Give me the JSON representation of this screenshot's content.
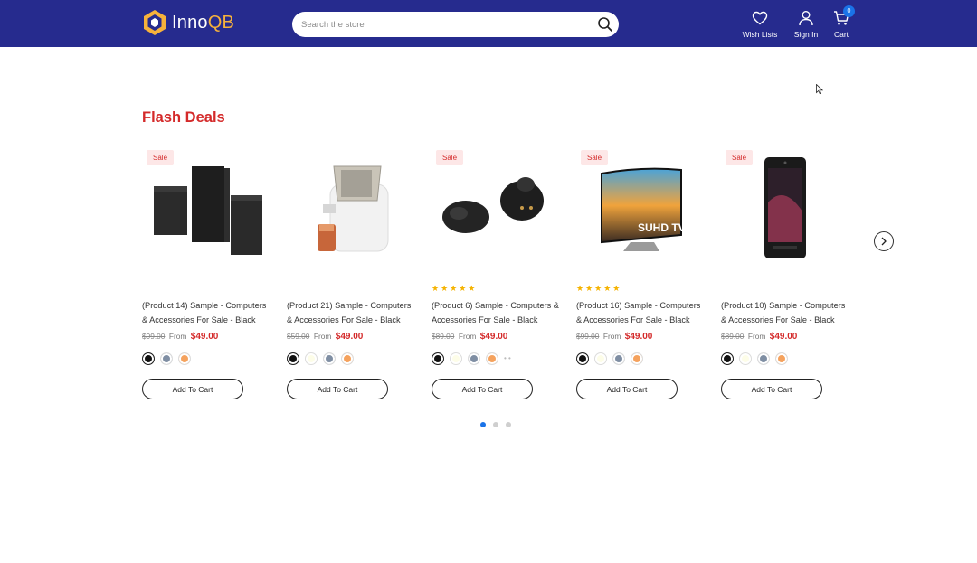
{
  "header": {
    "logo": {
      "part1": "Inno",
      "part2": "QB"
    },
    "search": {
      "placeholder": "Search the store"
    },
    "wishlist_label": "Wish Lists",
    "signin_label": "Sign In",
    "cart_label": "Cart",
    "cart_count": "0"
  },
  "section": {
    "title": "Flash Deals"
  },
  "colors": {
    "header_bg": "#262b8e",
    "accent": "#d42a2a",
    "logo_accent": "#f7b23b",
    "badge_blue": "#1a73e8"
  },
  "products": [
    {
      "badge": "Sale",
      "image": "speakers-image",
      "rated": false,
      "stars": "",
      "name": "(Product 14) Sample - Computers & Accessories For Sale - Black",
      "old_price": "$99.00",
      "from": "From",
      "price": "$49.00",
      "swatches": [
        "#111111",
        "#7f8ea3",
        "#f5a25d"
      ],
      "more": "",
      "button": "Add To Cart"
    },
    {
      "badge": "",
      "image": "juicer-image",
      "rated": false,
      "stars": "",
      "name": "(Product 21) Sample - Computers & Accessories For Sale - Black",
      "old_price": "$59.00",
      "from": "From",
      "price": "$49.00",
      "swatches": [
        "#111111",
        "#fdfde8",
        "#7f8ea3",
        "#f5a25d"
      ],
      "more": "",
      "button": "Add To Cart"
    },
    {
      "badge": "Sale",
      "image": "earbuds-image",
      "rated": true,
      "stars": "★★★★★",
      "name": "(Product 6) Sample - Computers & Accessories For Sale - Black",
      "old_price": "$89.00",
      "from": "From",
      "price": "$49.00",
      "swatches": [
        "#111111",
        "#fdfde8",
        "#7f8ea3",
        "#f5a25d"
      ],
      "more": "• •",
      "button": "Add To Cart"
    },
    {
      "badge": "Sale",
      "image": "tv-image",
      "rated": true,
      "stars": "★★★★★",
      "name": "(Product 16) Sample - Computers & Accessories For Sale - Black",
      "old_price": "$99.00",
      "from": "From",
      "price": "$49.00",
      "swatches": [
        "#111111",
        "#fdfde8",
        "#7f8ea3",
        "#f5a25d"
      ],
      "more": "",
      "button": "Add To Cart"
    },
    {
      "badge": "Sale",
      "image": "phone-image",
      "rated": false,
      "stars": "",
      "name": "(Product 10) Sample - Computers & Accessories For Sale - Black",
      "old_price": "$89.00",
      "from": "From",
      "price": "$49.00",
      "swatches": [
        "#111111",
        "#fdfde8",
        "#7f8ea3",
        "#f5a25d"
      ],
      "more": "",
      "button": "Add To Cart"
    }
  ],
  "carousel": {
    "pages": 3,
    "active_page": 1
  }
}
